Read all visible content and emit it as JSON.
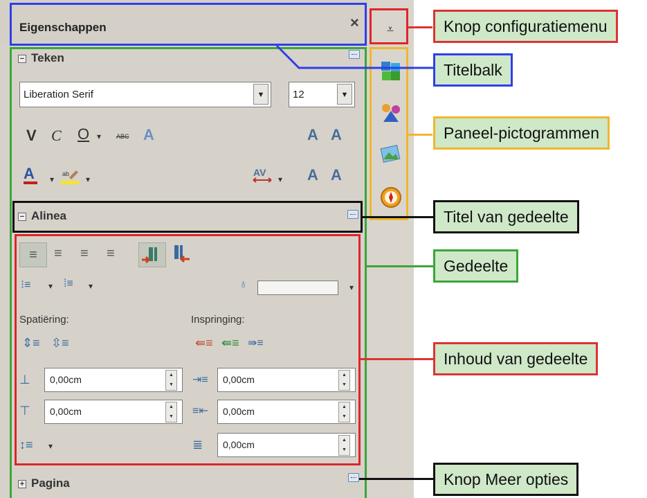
{
  "title_bar": {
    "title": "Eigenschappen",
    "close": "×"
  },
  "config_menu_button": {
    "glyph": "⩡"
  },
  "sections": {
    "teken": {
      "header": "Teken",
      "font_name": "Liberation Serif",
      "font_size": "12",
      "bold": "V",
      "italic": "C",
      "underline": "O",
      "strikethrough": "ABC",
      "shadow": "A"
    },
    "alinea": {
      "header": "Alinea",
      "spacing_label": "Spatiëring:",
      "indent_label": "Inspringing:",
      "above_spacing": "0,00cm",
      "below_spacing": "0,00cm",
      "before_indent": "0,00cm",
      "after_indent": "0,00cm",
      "first_line_indent": "0,00cm"
    },
    "pagina": {
      "header": "Pagina"
    }
  },
  "tab_icons": [
    "cube-icon",
    "styles-icon",
    "gallery-icon",
    "navigator-icon"
  ],
  "annotations": {
    "config_menu": "Knop configuratiemenu",
    "title_bar": "Titelbalk",
    "panel_icons": "Paneel-pictogrammen",
    "section_title": "Titel van gedeelte",
    "section": "Gedeelte",
    "section_content": "Inhoud van gedeelte",
    "more_options": "Knop Meer opties"
  },
  "colors": {
    "blue": "#2f3fe8",
    "red": "#e0242a",
    "green": "#3aa63a",
    "yellow": "#f0b72d",
    "callout_fill": "#cfe8c8"
  }
}
